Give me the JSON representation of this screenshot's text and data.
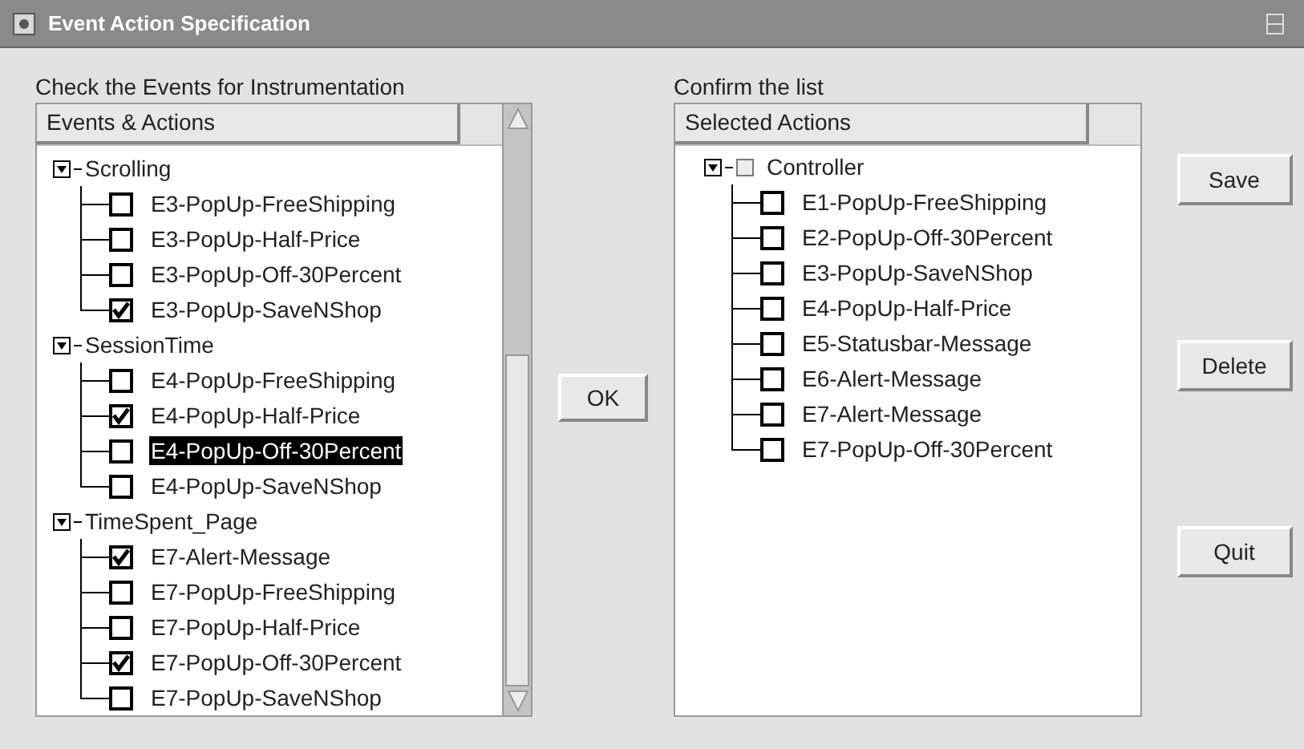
{
  "window": {
    "title": "Event Action Specification"
  },
  "left": {
    "label": "Check the Events for Instrumentation",
    "header": "Events & Actions",
    "groups": [
      {
        "name": "Scrolling",
        "expanded": true,
        "children": [
          {
            "label": "E3-PopUp-FreeShipping",
            "checked": false,
            "selected": false
          },
          {
            "label": "E3-PopUp-Half-Price",
            "checked": false,
            "selected": false
          },
          {
            "label": "E3-PopUp-Off-30Percent",
            "checked": false,
            "selected": false
          },
          {
            "label": "E3-PopUp-SaveNShop",
            "checked": true,
            "selected": false
          }
        ]
      },
      {
        "name": "SessionTime",
        "expanded": true,
        "children": [
          {
            "label": "E4-PopUp-FreeShipping",
            "checked": false,
            "selected": false
          },
          {
            "label": "E4-PopUp-Half-Price",
            "checked": true,
            "selected": false
          },
          {
            "label": "E4-PopUp-Off-30Percent",
            "checked": false,
            "selected": true
          },
          {
            "label": "E4-PopUp-SaveNShop",
            "checked": false,
            "selected": false
          }
        ]
      },
      {
        "name": "TimeSpent_Page",
        "expanded": true,
        "children": [
          {
            "label": "E7-Alert-Message",
            "checked": true,
            "selected": false
          },
          {
            "label": "E7-PopUp-FreeShipping",
            "checked": false,
            "selected": false
          },
          {
            "label": "E7-PopUp-Half-Price",
            "checked": false,
            "selected": false
          },
          {
            "label": "E7-PopUp-Off-30Percent",
            "checked": true,
            "selected": false
          },
          {
            "label": "E7-PopUp-SaveNShop",
            "checked": false,
            "selected": false
          }
        ]
      }
    ]
  },
  "ok_button": "OK",
  "right": {
    "label": "Confirm the list",
    "header": "Selected Actions",
    "groups": [
      {
        "name": "Controller",
        "expanded": true,
        "checked": false,
        "children": [
          {
            "label": "E1-PopUp-FreeShipping",
            "checked": false
          },
          {
            "label": "E2-PopUp-Off-30Percent",
            "checked": false
          },
          {
            "label": "E3-PopUp-SaveNShop",
            "checked": false
          },
          {
            "label": "E4-PopUp-Half-Price",
            "checked": false
          },
          {
            "label": "E5-Statusbar-Message",
            "checked": false
          },
          {
            "label": "E6-Alert-Message",
            "checked": false
          },
          {
            "label": "E7-Alert-Message",
            "checked": false
          },
          {
            "label": "E7-PopUp-Off-30Percent",
            "checked": false
          }
        ]
      }
    ]
  },
  "buttons": [
    "Save",
    "Delete",
    "Quit"
  ]
}
